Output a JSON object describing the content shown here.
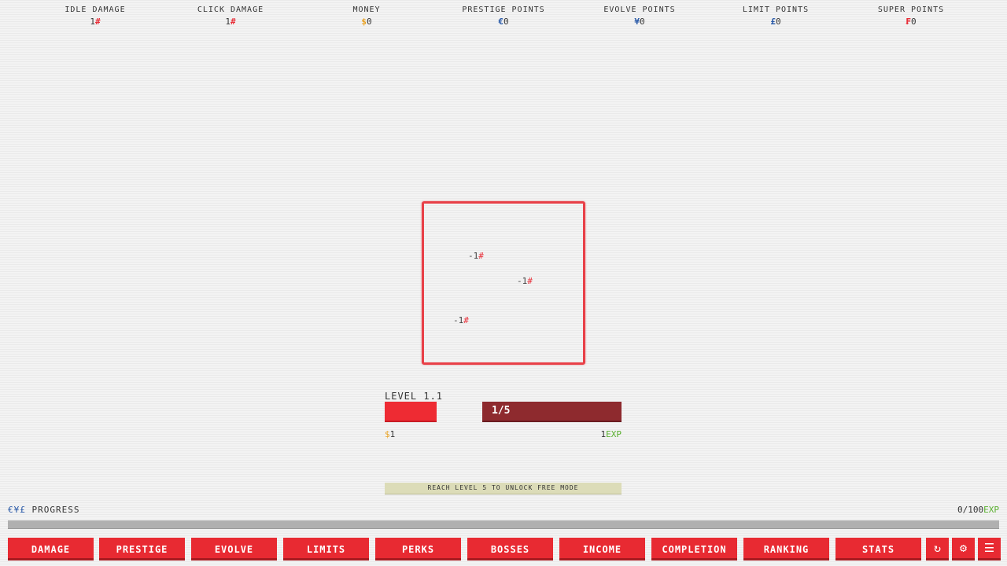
{
  "stats": [
    {
      "label": "IDLE DAMAGE",
      "value": "1",
      "symbol": "#"
    },
    {
      "label": "CLICK DAMAGE",
      "value": "1",
      "symbol": "#"
    },
    {
      "label": "MONEY",
      "value": "0",
      "symbol": "$"
    },
    {
      "label": "PRESTIGE POINTS",
      "value": "0",
      "symbol": "€"
    },
    {
      "label": "EVOLVE POINTS",
      "value": "0",
      "symbol": "¥"
    },
    {
      "label": "LIMIT POINTS",
      "value": "0",
      "symbol": "£"
    },
    {
      "label": "SUPER POINTS",
      "value": "0",
      "symbol": "₣"
    }
  ],
  "damage_popups": [
    {
      "value": "-1",
      "symbol": "#"
    },
    {
      "value": "-1",
      "symbol": "#"
    },
    {
      "value": "-1",
      "symbol": "#"
    }
  ],
  "level": {
    "label": "LEVEL 1.1",
    "kills": "1/5",
    "health_fraction": 0.37,
    "reward_money_symbol": "$",
    "reward_money": "1",
    "reward_exp": "1",
    "reward_exp_unit": "EXP"
  },
  "unlock_banner": "REACH LEVEL 5 TO UNLOCK FREE MODE",
  "progress": {
    "symbols": "€¥£",
    "label": "PROGRESS",
    "value": "0/100",
    "unit": "EXP",
    "fraction": 0
  },
  "nav": {
    "buttons": [
      "DAMAGE",
      "PRESTIGE",
      "EVOLVE",
      "LIMITS",
      "PERKS",
      "BOSSES",
      "INCOME",
      "COMPLETION",
      "RANKING",
      "STATS"
    ],
    "icons": [
      "refresh-icon",
      "gear-icon",
      "menu-icon"
    ]
  },
  "colors": {
    "accent_red": "#e82a32",
    "dark_red": "#8e2a2e",
    "money_gold": "#e8a020",
    "points_blue": "#2a5aa8",
    "exp_green": "#5ab030"
  }
}
